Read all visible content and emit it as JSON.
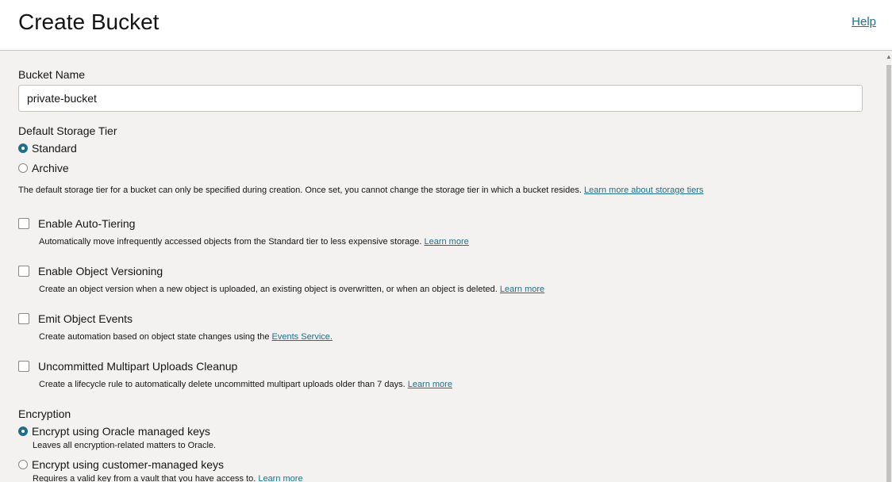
{
  "header": {
    "title": "Create Bucket",
    "help": "Help"
  },
  "bucket_name": {
    "label": "Bucket Name",
    "value": "private-bucket"
  },
  "storage_tier": {
    "label": "Default Storage Tier",
    "options": [
      {
        "label": "Standard",
        "checked": true
      },
      {
        "label": "Archive",
        "checked": false
      }
    ],
    "help": "The default storage tier for a bucket can only be specified during creation. Once set, you cannot change the storage tier in which a bucket resides.",
    "help_link": "Learn more about storage tiers"
  },
  "options": {
    "auto_tiering": {
      "label": "Enable Auto-Tiering",
      "help": "Automatically move infrequently accessed objects from the Standard tier to less expensive storage.",
      "link": "Learn more"
    },
    "versioning": {
      "label": "Enable Object Versioning",
      "help": "Create an object version when a new object is uploaded, an existing object is overwritten, or when an object is deleted.",
      "link": "Learn more"
    },
    "events": {
      "label": "Emit Object Events",
      "help": "Create automation based on object state changes using the",
      "link": "Events Service."
    },
    "multipart": {
      "label": "Uncommitted Multipart Uploads Cleanup",
      "help": "Create a lifecycle rule to automatically delete uncommitted multipart uploads older than 7 days.",
      "link": "Learn more"
    }
  },
  "encryption": {
    "label": "Encryption",
    "oracle": {
      "label": "Encrypt using Oracle managed keys",
      "help": "Leaves all encryption-related matters to Oracle.",
      "checked": true
    },
    "customer": {
      "label": "Encrypt using customer-managed keys",
      "help": "Requires a valid key from a vault that you have access to.",
      "link": "Learn more",
      "checked": false
    }
  },
  "colors": {
    "accent": "#1f6f8b",
    "background": "#f3f2f0",
    "header_bg": "#ffffff"
  }
}
